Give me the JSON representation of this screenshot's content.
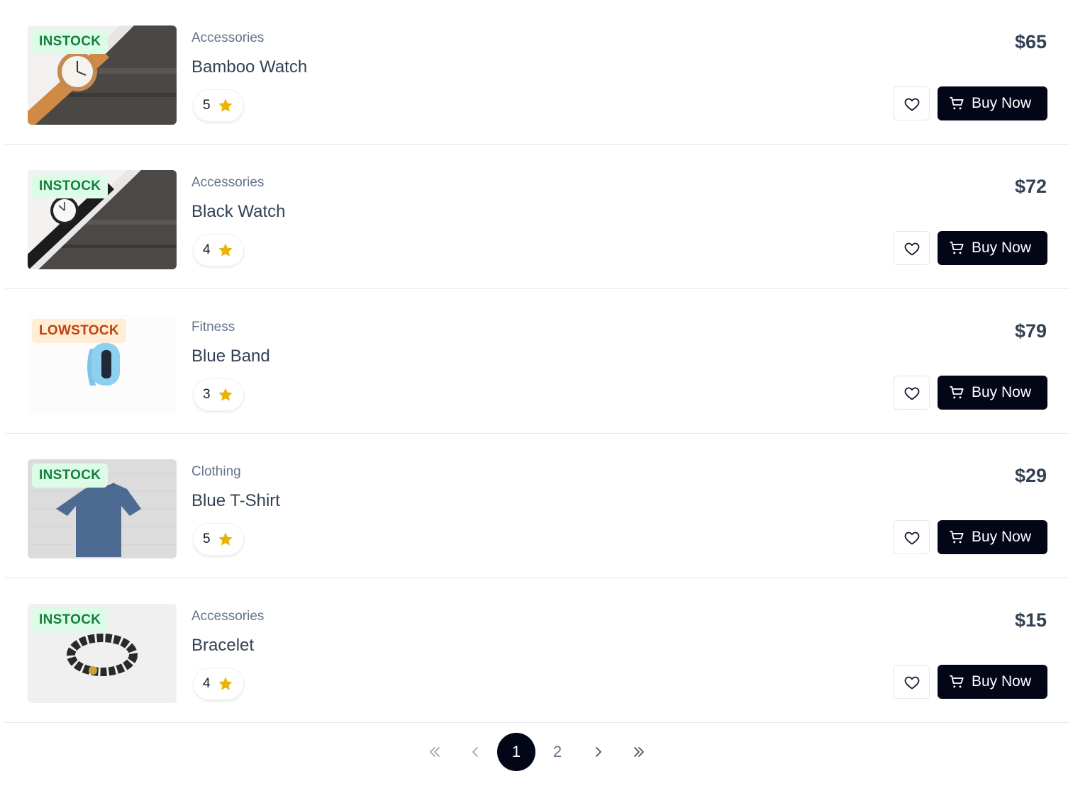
{
  "products": [
    {
      "badge": "INSTOCK",
      "category": "Accessories",
      "name": "Bamboo Watch",
      "rating": "5",
      "price": "$65",
      "buy_label": "Buy Now"
    },
    {
      "badge": "INSTOCK",
      "category": "Accessories",
      "name": "Black Watch",
      "rating": "4",
      "price": "$72",
      "buy_label": "Buy Now"
    },
    {
      "badge": "LOWSTOCK",
      "category": "Fitness",
      "name": "Blue Band",
      "rating": "3",
      "price": "$79",
      "buy_label": "Buy Now"
    },
    {
      "badge": "INSTOCK",
      "category": "Clothing",
      "name": "Blue T-Shirt",
      "rating": "5",
      "price": "$29",
      "buy_label": "Buy Now"
    },
    {
      "badge": "INSTOCK",
      "category": "Accessories",
      "name": "Bracelet",
      "rating": "4",
      "price": "$15",
      "buy_label": "Buy Now"
    }
  ],
  "pagination": {
    "pages": [
      "1",
      "2"
    ],
    "current": "1",
    "icons": [
      "first-page-icon",
      "prev-page-icon",
      "next-page-icon",
      "last-page-icon"
    ]
  },
  "colors": {
    "instock_bg": "#dcfce7",
    "instock_text": "#15803d",
    "lowstock_bg": "#ffedd5",
    "lowstock_text": "#c2410c",
    "primary_button": "#020617",
    "star": "#eab308"
  }
}
